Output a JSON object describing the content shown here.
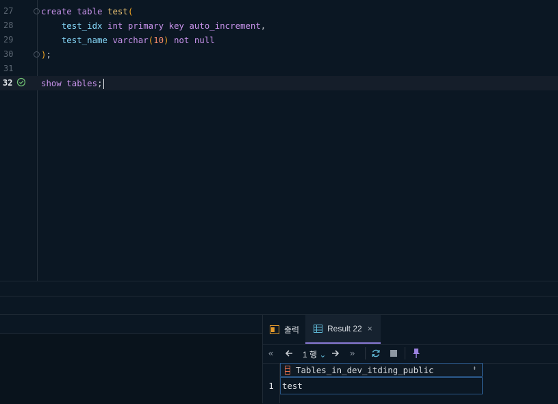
{
  "editor": {
    "lines": [
      {
        "num": "27",
        "parts": [
          [
            "kw",
            "create table "
          ],
          [
            "fn",
            "test"
          ],
          [
            "paren",
            "("
          ]
        ]
      },
      {
        "num": "28",
        "parts": [
          [
            "id",
            "    test_idx "
          ],
          [
            "kw",
            "int primary key auto_increment"
          ],
          [
            "punc",
            ","
          ]
        ]
      },
      {
        "num": "29",
        "parts": [
          [
            "id",
            "    test_name "
          ],
          [
            "kw",
            "varchar"
          ],
          [
            "paren",
            "("
          ],
          [
            "num",
            "10"
          ],
          [
            "paren",
            ")"
          ],
          [
            "kw",
            " not null"
          ]
        ]
      },
      {
        "num": "30",
        "parts": [
          [
            "paren",
            ")"
          ],
          [
            "punc",
            ";"
          ]
        ]
      },
      {
        "num": "31",
        "parts": []
      },
      {
        "num": "32",
        "parts": [
          [
            "kw",
            "show tables"
          ],
          [
            "punc",
            ";"
          ]
        ]
      }
    ]
  },
  "colors": {
    "accent": "#8b7bd8",
    "keyword": "#c792ea",
    "identifier": "#89ddff",
    "function": "#f0c674",
    "number": "#f78c6c",
    "background": "#0b1723"
  },
  "tabs": {
    "output": {
      "label": "출력",
      "icon": "output-icon"
    },
    "result": {
      "label": "Result 22",
      "icon": "table-icon",
      "close": "×"
    }
  },
  "toolbar": {
    "rows_label": "1 행"
  },
  "grid": {
    "column_header": "Tables_in_dev_itding_public",
    "rows": [
      {
        "num": "1",
        "value": "test"
      }
    ]
  }
}
